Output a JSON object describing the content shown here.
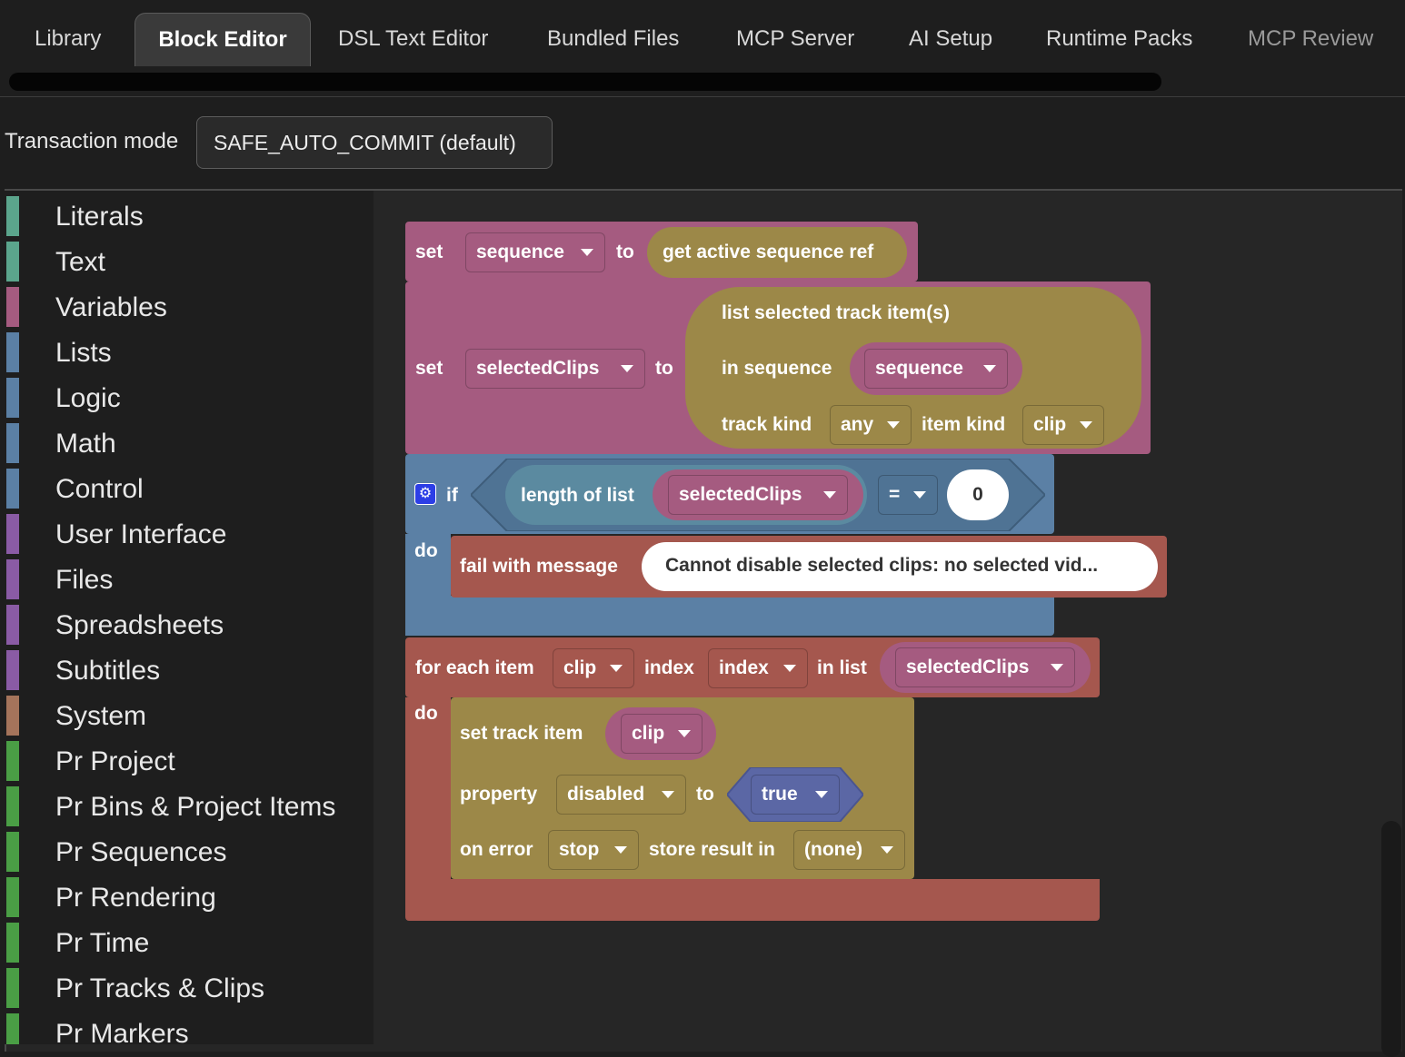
{
  "tabs": [
    {
      "label": "Library",
      "active": false
    },
    {
      "label": "Block Editor",
      "active": true
    },
    {
      "label": "DSL Text Editor",
      "active": false
    },
    {
      "label": "Bundled Files",
      "active": false
    },
    {
      "label": "MCP Server",
      "active": false
    },
    {
      "label": "AI Setup",
      "active": false
    },
    {
      "label": "Runtime Packs",
      "active": false
    },
    {
      "label": "MCP Review",
      "active": false
    }
  ],
  "transaction": {
    "label": "Transaction mode",
    "value": "SAFE_AUTO_COMMIT (default)"
  },
  "toolbox": [
    {
      "label": "Literals",
      "color": "#5ba58c"
    },
    {
      "label": "Text",
      "color": "#5ba58c"
    },
    {
      "label": "Variables",
      "color": "#a55b80"
    },
    {
      "label": "Lists",
      "color": "#5b80a5"
    },
    {
      "label": "Logic",
      "color": "#5b80a5"
    },
    {
      "label": "Math",
      "color": "#5b80a5"
    },
    {
      "label": "Control",
      "color": "#5b80a5"
    },
    {
      "label": "User Interface",
      "color": "#8a5ba5"
    },
    {
      "label": "Files",
      "color": "#8a5ba5"
    },
    {
      "label": "Spreadsheets",
      "color": "#8a5ba5"
    },
    {
      "label": "Subtitles",
      "color": "#8a5ba5"
    },
    {
      "label": "System",
      "color": "#a5745b"
    },
    {
      "label": "Pr Project",
      "color": "#4a9e45"
    },
    {
      "label": "Pr Bins & Project Items",
      "color": "#4a9e45"
    },
    {
      "label": "Pr Sequences",
      "color": "#4a9e45"
    },
    {
      "label": "Pr Rendering",
      "color": "#4a9e45"
    },
    {
      "label": "Pr Time",
      "color": "#4a9e45"
    },
    {
      "label": "Pr Tracks & Clips",
      "color": "#4a9e45"
    },
    {
      "label": "Pr Markers",
      "color": "#4a9e45"
    }
  ],
  "blocks": {
    "set1": {
      "kw": "set",
      "var": "sequence",
      "to": "to",
      "call": "get active sequence ref"
    },
    "set2": {
      "kw": "set",
      "var": "selectedClips",
      "to": "to",
      "call": "list selected track item(s)",
      "in_seq": "in sequence",
      "seq_var": "sequence",
      "track_kind": "track kind",
      "track_val": "any",
      "item_kind": "item kind",
      "item_val": "clip"
    },
    "if1": {
      "kw": "if",
      "do": "do",
      "length": "length of list",
      "list_var": "selectedClips",
      "op": "=",
      "num": "0",
      "fail": "fail with message",
      "message": "Cannot disable selected clips: no selected vid..."
    },
    "foreach": {
      "kw": "for each item",
      "item_var": "clip",
      "index_kw": "index",
      "index_var": "index",
      "in_list": "in list",
      "list_var": "selectedClips",
      "do": "do",
      "settrack": "set track item",
      "clip_var": "clip",
      "property": "property",
      "prop_val": "disabled",
      "to": "to",
      "bool": "true",
      "on_error": "on error",
      "err_val": "stop",
      "store": "store result in",
      "store_val": "(none)"
    }
  },
  "colors": {
    "variables": "#a55b80",
    "variables_dark": "#8a4567",
    "premiere": "#9c8848",
    "premiere_dark": "#7e6c34",
    "logic": "#5b80a5",
    "lists": "#745ba5",
    "list_length": "#5b8aa0",
    "system": "#a5574e",
    "bool": "#5b67a5"
  }
}
